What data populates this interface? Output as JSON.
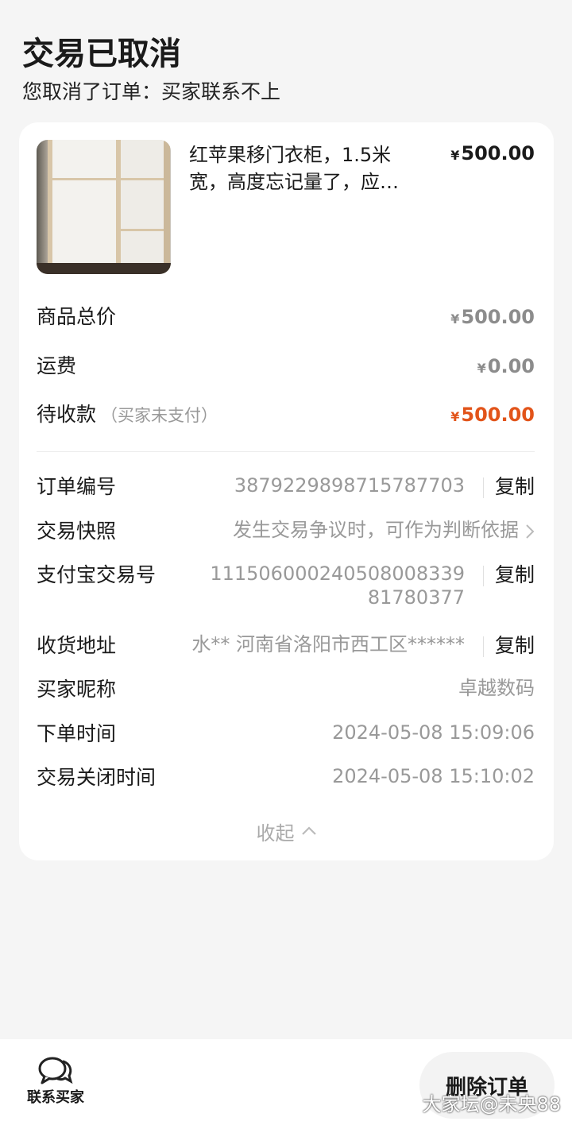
{
  "header": {
    "title": "交易已取消",
    "subtitle": "您取消了订单：买家联系不上"
  },
  "product": {
    "name": "红苹果移门衣柜，1.5米宽，高度忘记量了，应…",
    "price_symbol": "¥",
    "price": "500.00"
  },
  "summary": {
    "total_label": "商品总价",
    "total_symbol": "¥",
    "total_value": "500.00",
    "shipping_label": "运费",
    "shipping_symbol": "¥",
    "shipping_value": "0.00",
    "pending_label": "待收款",
    "pending_note": "（买家未支付）",
    "pending_symbol": "¥",
    "pending_value": "500.00"
  },
  "info": {
    "order_no_label": "订单编号",
    "order_no": "3879229898715787703",
    "snapshot_label": "交易快照",
    "snapshot_value": "发生交易争议时，可作为判断依据",
    "alipay_label": "支付宝交易号",
    "alipay_line1": "111506000240508008339",
    "alipay_line2": "81780377",
    "address_label": "收货地址",
    "address_value": "水** 河南省洛阳市西工区******",
    "buyer_nick_label": "买家昵称",
    "buyer_nick": "卓越数码",
    "order_time_label": "下单时间",
    "order_time": "2024-05-08 15:09:06",
    "close_time_label": "交易关闭时间",
    "close_time": "2024-05-08 15:10:02",
    "copy_label": "复制",
    "collapse_label": "收起"
  },
  "bottom": {
    "contact_label": "联系买家",
    "delete_label": "删除订单"
  },
  "watermark": "大家坛@未央88",
  "colors": {
    "accent_orange": "#e2541a",
    "background": "#f5f5f5"
  }
}
